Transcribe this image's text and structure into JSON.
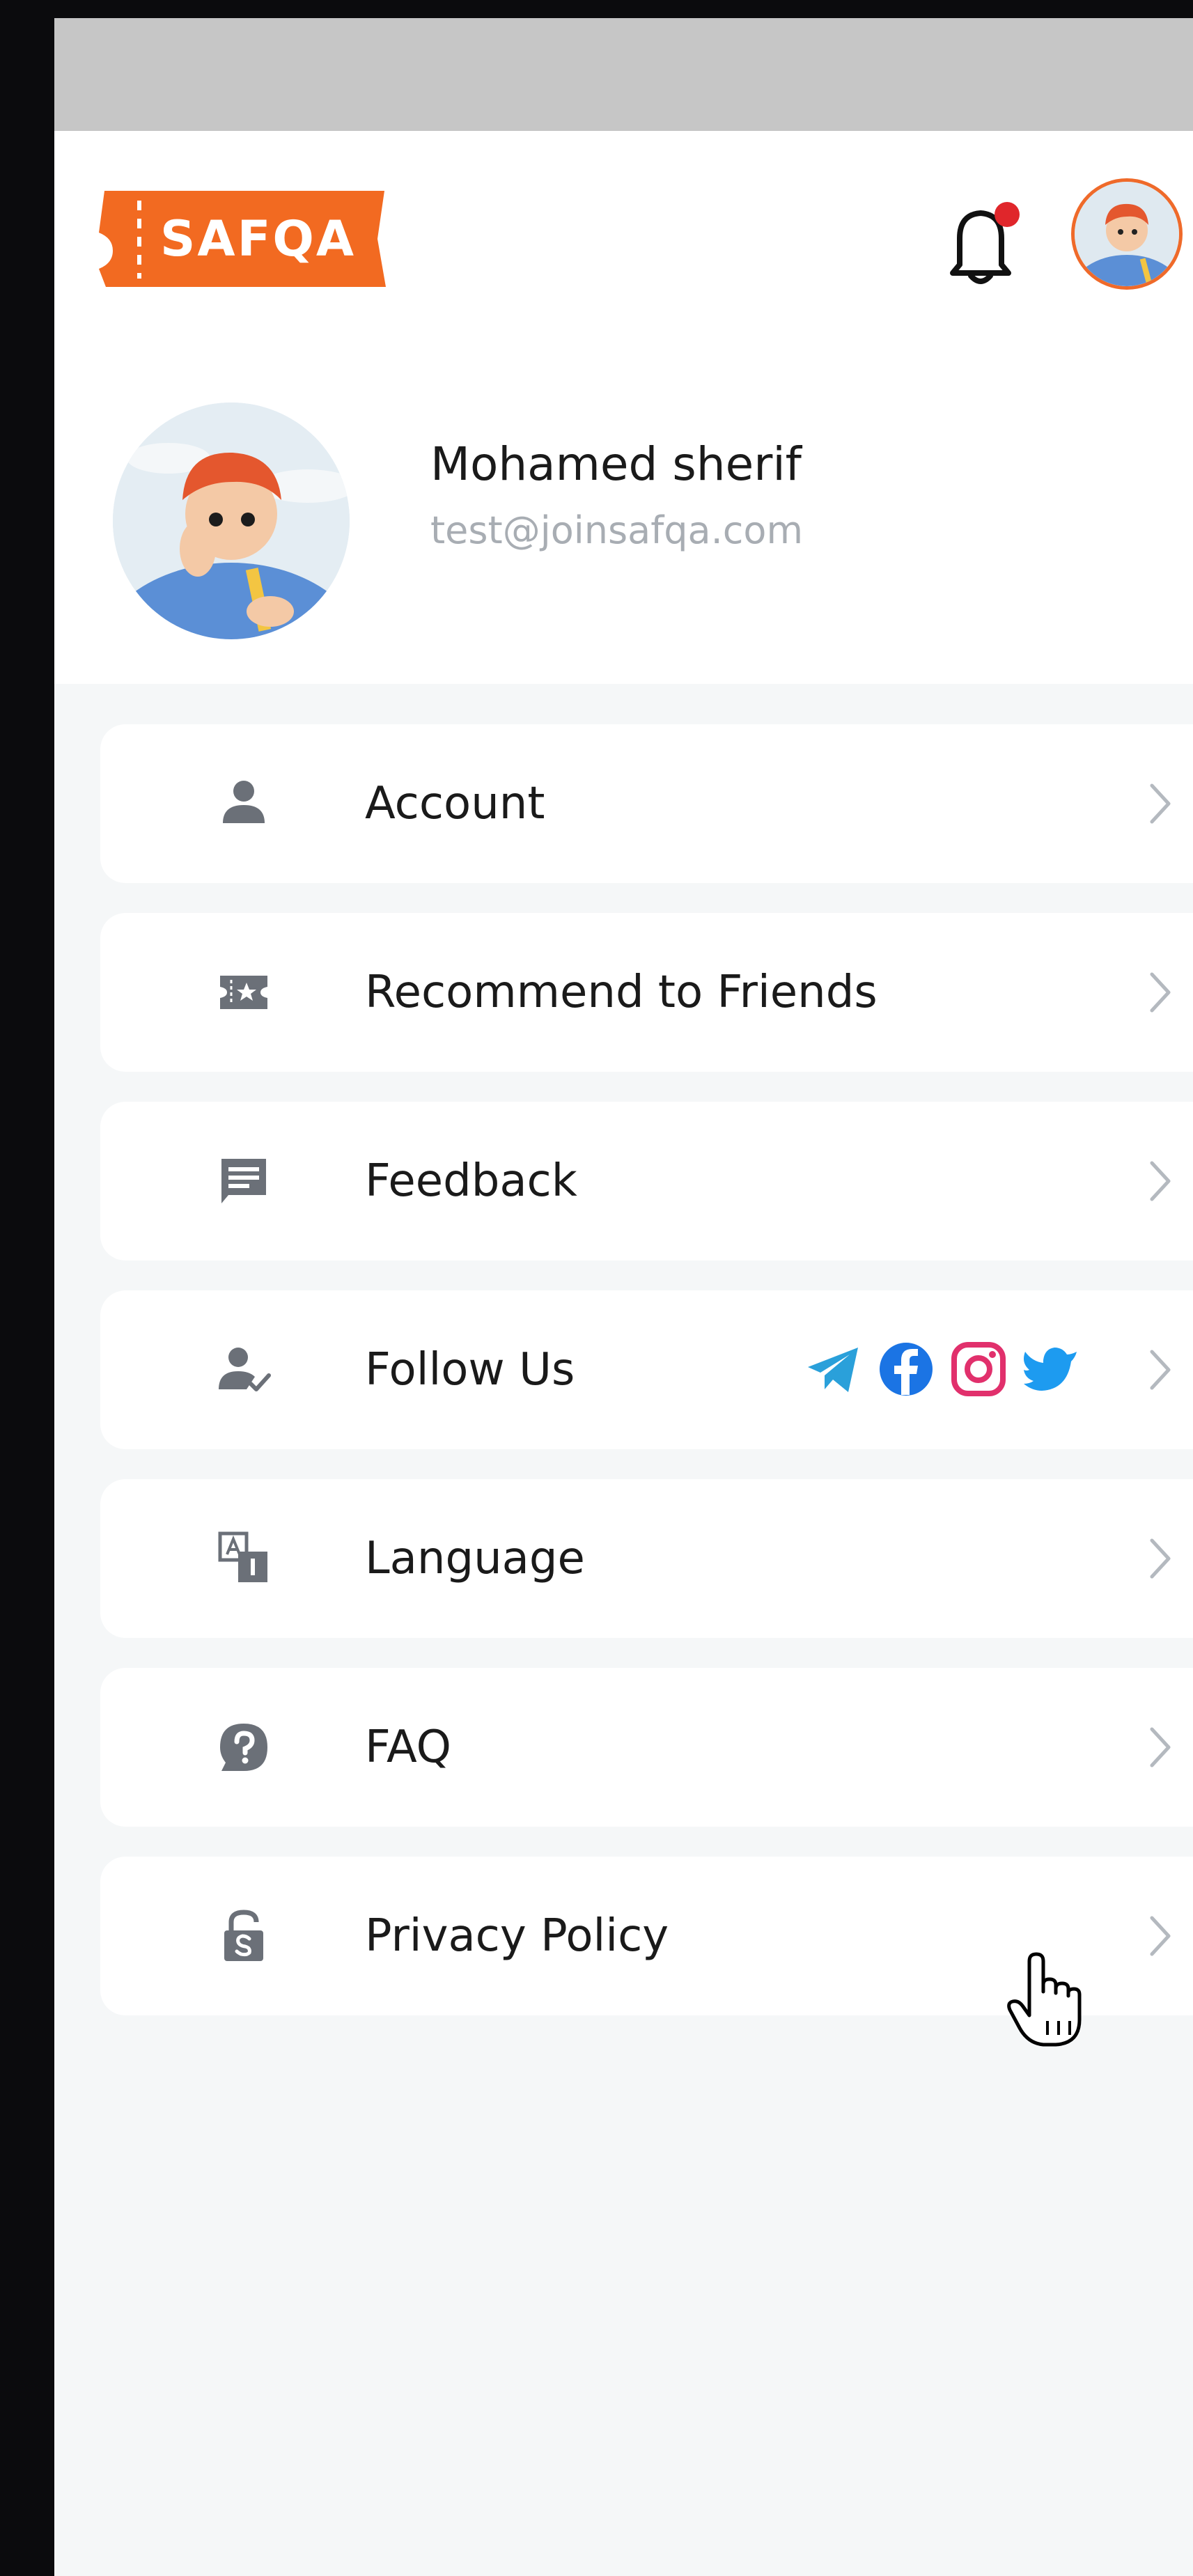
{
  "app": {
    "logo_text": "SAFQA",
    "brand_color": "#f26a21",
    "notification_dot_color": "#e0262b"
  },
  "profile": {
    "name": "Mohamed sherif",
    "email": "test@joinsafqa.com"
  },
  "menu": {
    "items": [
      {
        "label": "Account",
        "icon": "person-icon"
      },
      {
        "label": "Recommend to Friends",
        "icon": "recommend-ticket-icon"
      },
      {
        "label": "Feedback",
        "icon": "feedback-message-icon"
      },
      {
        "label": "Follow Us",
        "icon": "person-check-icon"
      },
      {
        "label": "Language",
        "icon": "language-icon"
      },
      {
        "label": "FAQ",
        "icon": "help-bubble-icon"
      },
      {
        "label": "Privacy Policy",
        "icon": "lock-dollar-icon"
      }
    ]
  },
  "socials": [
    {
      "name": "telegram-icon",
      "color": "#2aa0da"
    },
    {
      "name": "facebook-icon",
      "color": "#1b74e4"
    },
    {
      "name": "instagram-icon",
      "color": "#e1306c"
    },
    {
      "name": "twitter-icon",
      "color": "#1d9bf0"
    }
  ]
}
